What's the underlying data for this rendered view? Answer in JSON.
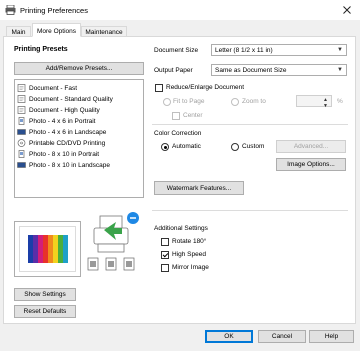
{
  "window": {
    "title": "Printing Preferences",
    "close_glyph": "✕"
  },
  "tabs": [
    {
      "label": "Main"
    },
    {
      "label": "More Options"
    },
    {
      "label": "Maintenance"
    }
  ],
  "printing_presets": {
    "heading": "Printing Presets",
    "add_remove_button": "Add/Remove Presets...",
    "items": [
      {
        "label": "Document - Fast",
        "icon": "document-icon"
      },
      {
        "label": "Document - Standard Quality",
        "icon": "document-icon"
      },
      {
        "label": "Document - High Quality",
        "icon": "document-icon"
      },
      {
        "label": "Photo - 4 x 6 in Portrait",
        "icon": "photo-portrait-icon"
      },
      {
        "label": "Photo - 4 x 6 in Landscape",
        "icon": "photo-landscape-icon"
      },
      {
        "label": "Printable CD/DVD Printing",
        "icon": "cd-icon"
      },
      {
        "label": "Photo - 8 x 10 in Portrait",
        "icon": "photo-portrait-icon"
      },
      {
        "label": "Photo - 8 x 10 in Landscape",
        "icon": "photo-landscape-icon"
      }
    ],
    "show_settings_button": "Show Settings",
    "reset_defaults_button": "Reset Defaults"
  },
  "document_size": {
    "label": "Document Size",
    "value": "Letter (8 1/2 x 11 in)"
  },
  "output_paper": {
    "label": "Output Paper",
    "value": "Same as Document Size"
  },
  "reduce_enlarge": {
    "label": "Reduce/Enlarge Document",
    "checked": false,
    "fit_to_page": "Fit to Page",
    "zoom_to": "Zoom to",
    "percent": "%",
    "center": "Center"
  },
  "color_correction": {
    "heading": "Color Correction",
    "automatic": "Automatic",
    "custom": "Custom",
    "selected": "Automatic",
    "advanced_button": "Advanced...",
    "image_options_button": "Image Options..."
  },
  "watermark_button": "Watermark Features...",
  "additional_settings": {
    "heading": "Additional Settings",
    "rotate": {
      "label": "Rotate 180°",
      "checked": false
    },
    "high_speed": {
      "label": "High Speed",
      "checked": true
    },
    "mirror_image": {
      "label": "Mirror Image",
      "checked": false
    }
  },
  "footer": {
    "ok": "OK",
    "cancel": "Cancel",
    "help": "Help"
  },
  "colors": {
    "accent": "#0078d7",
    "panel_bg": "#ffffff",
    "window_bg": "#f0f0f0"
  }
}
